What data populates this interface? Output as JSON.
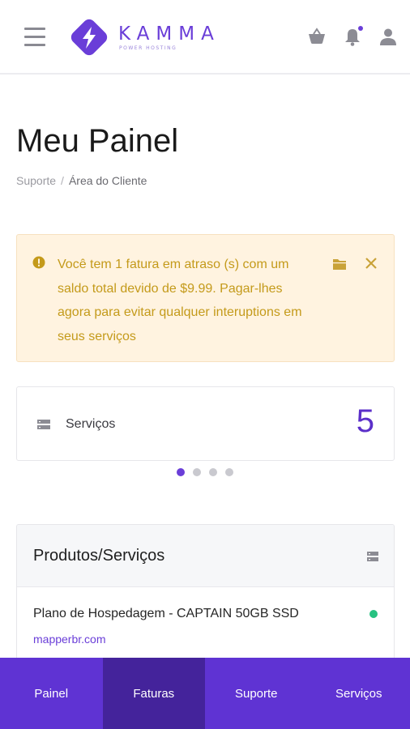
{
  "brand": {
    "name": "KAMMA",
    "tagline": "POWER HOSTING",
    "accent": "#6a3ed8"
  },
  "header": {
    "icons": [
      "menu-icon",
      "basket-icon",
      "bell-icon",
      "user-icon"
    ],
    "notification_dot": true
  },
  "page": {
    "title": "Meu Painel",
    "breadcrumb": [
      {
        "label": "Suporte"
      },
      {
        "separator": "/"
      },
      {
        "label": "Área do Cliente"
      }
    ]
  },
  "alert": {
    "message": "Você tem 1 fatura em atraso (s) com um saldo total devido de $9.99. Pagar-lhes agora para evitar qualquer interuptions em seus serviços",
    "icons": [
      "warning-icon",
      "folder-icon",
      "close-icon"
    ],
    "background": "#fff3e0",
    "text_color": "#c49a1a"
  },
  "stats": {
    "label": "Serviços",
    "value": "5",
    "carousel": {
      "count": 4,
      "active_index": 0
    }
  },
  "products": {
    "title": "Produtos/Serviços",
    "items": [
      {
        "name": "Plano de Hospedagem - CAPTAIN 50GB SSD",
        "domain": "mapperbr.com",
        "status_color": "#27c281"
      }
    ]
  },
  "bottom_nav": {
    "items": [
      {
        "label": "Painel",
        "active": false
      },
      {
        "label": "Faturas",
        "active": true
      },
      {
        "label": "Suporte",
        "active": false
      },
      {
        "label": "Serviços",
        "active": false
      }
    ],
    "background": "#5f33d3",
    "active_background": "#44239b"
  }
}
